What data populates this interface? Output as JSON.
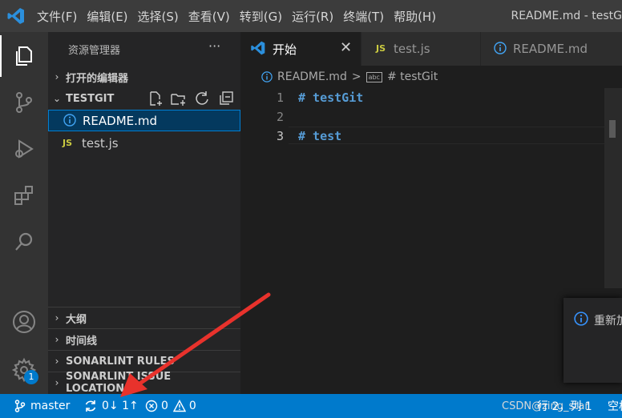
{
  "menu": [
    "文件(F)",
    "编辑(E)",
    "选择(S)",
    "查看(V)",
    "转到(G)",
    "运行(R)",
    "终端(T)",
    "帮助(H)"
  ],
  "window_title": "README.md - testG",
  "sidebar": {
    "title": "资源管理器",
    "more": "···",
    "open_editors": "打开的编辑器",
    "folder": "TESTGIT",
    "files": [
      {
        "name": "README.md",
        "icon": "info-icon"
      },
      {
        "name": "test.js",
        "icon": "js-icon",
        "badge": "JS"
      }
    ],
    "sections": [
      "大纲",
      "时间线",
      "SONARLINT RULES",
      "SONARLINT ISSUE LOCATIONS"
    ]
  },
  "tabs": [
    {
      "label": "开始",
      "icon": "vscode-logo-icon",
      "active": true
    },
    {
      "label": "test.js",
      "icon": "js-icon",
      "badge": "JS"
    },
    {
      "label": "README.md",
      "icon": "info-icon"
    }
  ],
  "breadcrumb": {
    "file": "README.md",
    "separator": ">",
    "symbol": "# testGit",
    "symbol_icon": "abc"
  },
  "editor": {
    "lines": [
      {
        "num": "1",
        "text": "# testGit"
      },
      {
        "num": "2",
        "text": ""
      },
      {
        "num": "3",
        "text": "# test"
      }
    ]
  },
  "notification": {
    "text": "重新加"
  },
  "status": {
    "branch": "master",
    "sync": "0↓ 1↑",
    "errors": "0",
    "warnings": "0",
    "position": "行 2，列 1",
    "spaces": "空格",
    "watermark": "CSDN@zing_star"
  },
  "accounts_badge": "1",
  "colors": {
    "accent": "#007acc",
    "title_bg": "#3c3c3c",
    "sidebar_bg": "#252526",
    "editor_bg": "#1e1e1e",
    "arrow": "#e8322c",
    "selection": "#04395e"
  }
}
